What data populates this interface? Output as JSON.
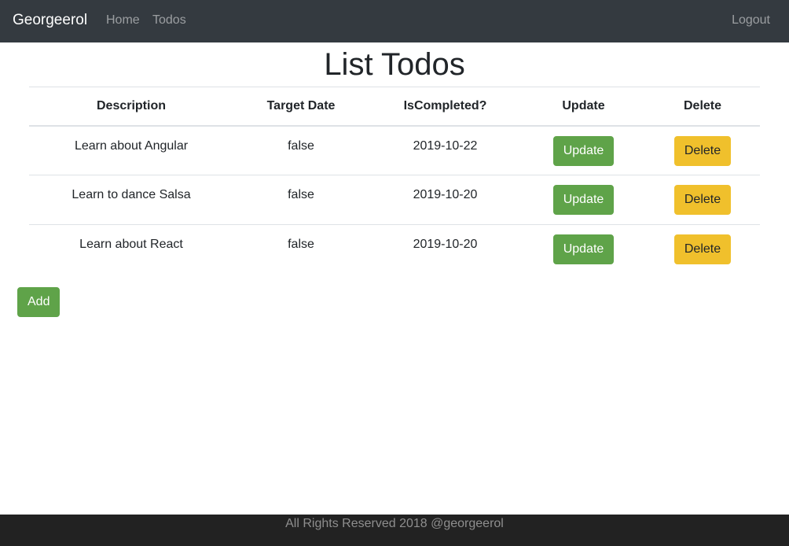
{
  "nav": {
    "brand": "Georgeerol",
    "links": [
      "Home",
      "Todos"
    ],
    "logout": "Logout"
  },
  "page": {
    "title": "List Todos"
  },
  "table": {
    "headers": [
      "Description",
      "Target Date",
      "IsCompleted?",
      "Update",
      "Delete"
    ],
    "rows": [
      {
        "description": "Learn about Angular",
        "target_date": "false",
        "is_completed": "2019-10-22",
        "update_label": "Update",
        "delete_label": "Delete"
      },
      {
        "description": "Learn to dance Salsa",
        "target_date": "false",
        "is_completed": "2019-10-20",
        "update_label": "Update",
        "delete_label": "Delete"
      },
      {
        "description": "Learn about React",
        "target_date": "false",
        "is_completed": "2019-10-20",
        "update_label": "Update",
        "delete_label": "Delete"
      }
    ]
  },
  "actions": {
    "add_label": "Add"
  },
  "footer": {
    "text": "All Rights Reserved 2018 @georgeerol"
  },
  "colors": {
    "navbar_bg": "#343a40",
    "success": "#5fa349",
    "warning": "#f0c02c",
    "footer_bg": "#222222"
  }
}
